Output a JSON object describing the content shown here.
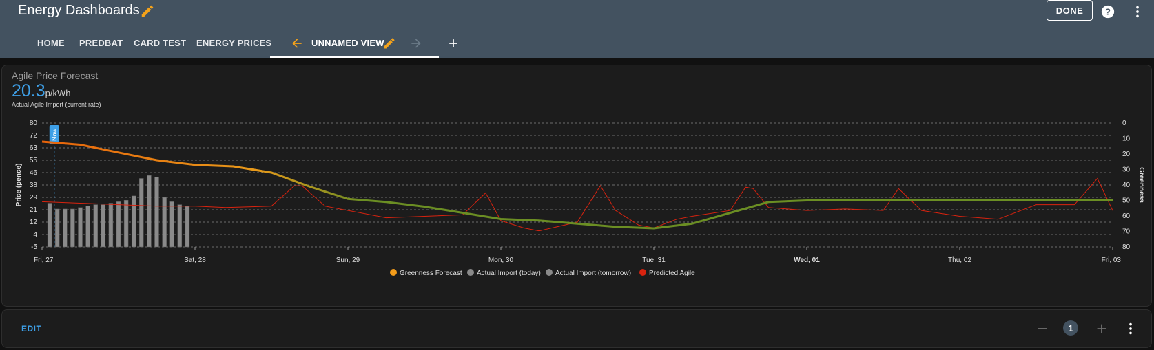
{
  "app": {
    "title": "Energy Dashboards",
    "done_label": "DONE"
  },
  "tabs": [
    {
      "label": "HOME"
    },
    {
      "label": "PREDBAT"
    },
    {
      "label": "CARD TEST"
    },
    {
      "label": "ENERGY PRICES"
    },
    {
      "label": "UNNAMED VIEW",
      "active": true
    }
  ],
  "card": {
    "title": "Agile Price Forecast",
    "value": "20.3",
    "unit": "p/kWh",
    "subtitle": "Actual Agile Import (current rate)"
  },
  "colors": {
    "accent": "#3ea0e8",
    "toolbar": "#435260",
    "greenness_early": "#e8630a",
    "greenness_late": "#6b8e23",
    "actual": "#8a8a8a",
    "predicted": "#d9230f",
    "tab_icon": "#f4a21a"
  },
  "chart_data": {
    "type": "line",
    "ylabel": "Price (pence)",
    "y2label": "Greenness",
    "y_ticks": [
      "80",
      "72",
      "63",
      "55",
      "46",
      "38",
      "29",
      "21",
      "12",
      "4",
      "-5"
    ],
    "y2_ticks": [
      "0",
      "10",
      "20",
      "30",
      "40",
      "50",
      "60",
      "70",
      "80"
    ],
    "ylim": [
      -5,
      80
    ],
    "y2lim": [
      80,
      0
    ],
    "x_ticks": [
      "Fri, 27",
      "Sat, 28",
      "Sun, 29",
      "Mon, 30",
      "Tue, 31",
      "Wed, 01",
      "Thu, 02",
      "Fri, 03"
    ],
    "now_label": "Now",
    "grid": true,
    "legend_position": "bottom",
    "series": [
      {
        "name": "Greenness Forecast",
        "axis": "right",
        "x": [
          0,
          0.25,
          0.5,
          0.75,
          1.0,
          1.25,
          1.5,
          1.75,
          2.0,
          2.25,
          2.5,
          2.75,
          3.0,
          3.25,
          3.5,
          3.75,
          4.0,
          4.25,
          4.5,
          4.75,
          5.0,
          5.25,
          5.5,
          5.75,
          6.0,
          6.25,
          6.5,
          6.75,
          7.0
        ],
        "values": [
          12,
          14,
          19,
          24,
          27,
          28,
          32,
          41,
          49,
          51,
          54,
          58,
          62,
          63,
          65,
          67,
          68,
          65,
          58,
          51,
          50,
          50,
          50,
          50,
          50,
          50,
          50,
          50,
          50
        ]
      },
      {
        "name": "Actual Import (today)",
        "x": [
          0.05,
          0.1,
          0.15,
          0.2,
          0.25,
          0.3,
          0.35,
          0.4,
          0.45,
          0.5,
          0.55,
          0.6,
          0.65,
          0.7,
          0.75,
          0.8,
          0.85,
          0.9,
          0.95
        ],
        "values": [
          25,
          21,
          21,
          21,
          22,
          23,
          24,
          24,
          25,
          26,
          27,
          30,
          42,
          44,
          43,
          29,
          26,
          24,
          23
        ]
      },
      {
        "name": "Actual Import (tomorrow)",
        "x": [],
        "values": []
      },
      {
        "name": "Predicted Agile",
        "x": [
          0,
          0.25,
          0.5,
          0.75,
          1.0,
          1.2,
          1.5,
          1.65,
          1.7,
          1.85,
          2.0,
          2.25,
          2.5,
          2.75,
          2.9,
          3.0,
          3.15,
          3.25,
          3.5,
          3.65,
          3.75,
          3.9,
          4.0,
          4.15,
          4.25,
          4.5,
          4.6,
          4.65,
          4.75,
          5.0,
          5.25,
          5.5,
          5.6,
          5.75,
          6.0,
          6.25,
          6.5,
          6.75,
          6.9,
          7.0
        ],
        "values": [
          26,
          25,
          24,
          23,
          23,
          22,
          23,
          37,
          37,
          23,
          20,
          15,
          16,
          17,
          32,
          13,
          8,
          6,
          12,
          37,
          20,
          10,
          8,
          14,
          16,
          20,
          36,
          35,
          22,
          20,
          21,
          20,
          35,
          20,
          16,
          14,
          24,
          24,
          42,
          20
        ]
      }
    ]
  }
}
